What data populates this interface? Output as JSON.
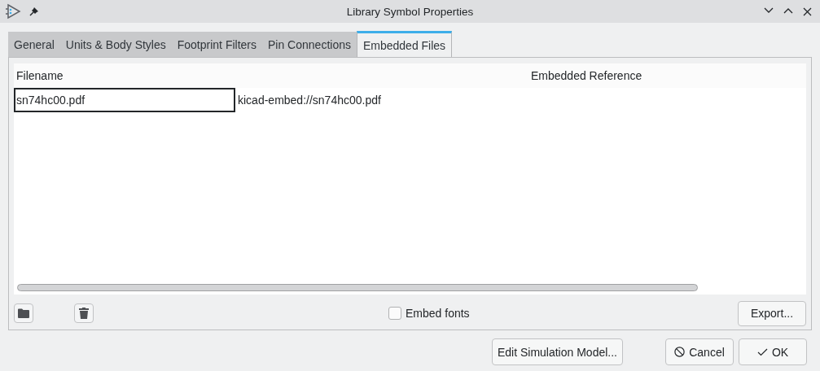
{
  "window": {
    "title": "Library Symbol Properties"
  },
  "tabs": [
    {
      "label": "General",
      "selected": false
    },
    {
      "label": "Units & Body Styles",
      "selected": false
    },
    {
      "label": "Footprint Filters",
      "selected": false
    },
    {
      "label": "Pin Connections",
      "selected": false
    },
    {
      "label": "Embedded Files",
      "selected": true
    }
  ],
  "table": {
    "columns": [
      "Filename",
      "Embedded Reference"
    ],
    "rows": [
      {
        "filename": "sn74hc00.pdf",
        "reference": "kicad-embed://sn74hc00.pdf",
        "editing": true
      }
    ]
  },
  "embed_fonts": {
    "label": "Embed fonts",
    "checked": false
  },
  "export_button": "Export...",
  "buttons": [
    {
      "label": "Edit Simulation Model...",
      "kind": "plain"
    },
    {
      "label": "Cancel",
      "kind": "cancel"
    },
    {
      "label": "OK",
      "kind": "ok"
    }
  ]
}
